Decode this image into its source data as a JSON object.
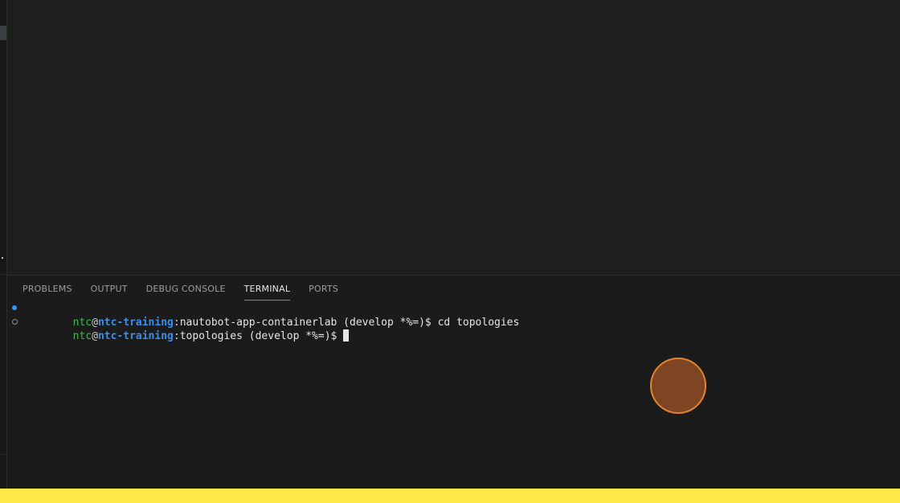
{
  "panel": {
    "tabs": [
      {
        "label": "PROBLEMS",
        "active": false
      },
      {
        "label": "OUTPUT",
        "active": false
      },
      {
        "label": "DEBUG CONSOLE",
        "active": false
      },
      {
        "label": "TERMINAL",
        "active": true
      },
      {
        "label": "PORTS",
        "active": false
      }
    ]
  },
  "terminal": {
    "lines": [
      {
        "status": "completed",
        "user": "ntc",
        "at": "@",
        "host": "ntc-training",
        "colon": ":",
        "path": "nautobot-app-containerlab (develop *%=)$",
        "command": " cd topologies"
      },
      {
        "status": "pending",
        "user": "ntc",
        "at": "@",
        "host": "ntc-training",
        "colon": ":",
        "path": "topologies (develop *%=)$",
        "command": " "
      }
    ]
  },
  "colors": {
    "user": "#3fb950",
    "host": "#3b8eea",
    "active_tab_underline": "#3794ff",
    "click_indicator_fill": "#7d4522",
    "click_indicator_border": "#e4832f",
    "highlight_bar": "#ffe84a"
  }
}
